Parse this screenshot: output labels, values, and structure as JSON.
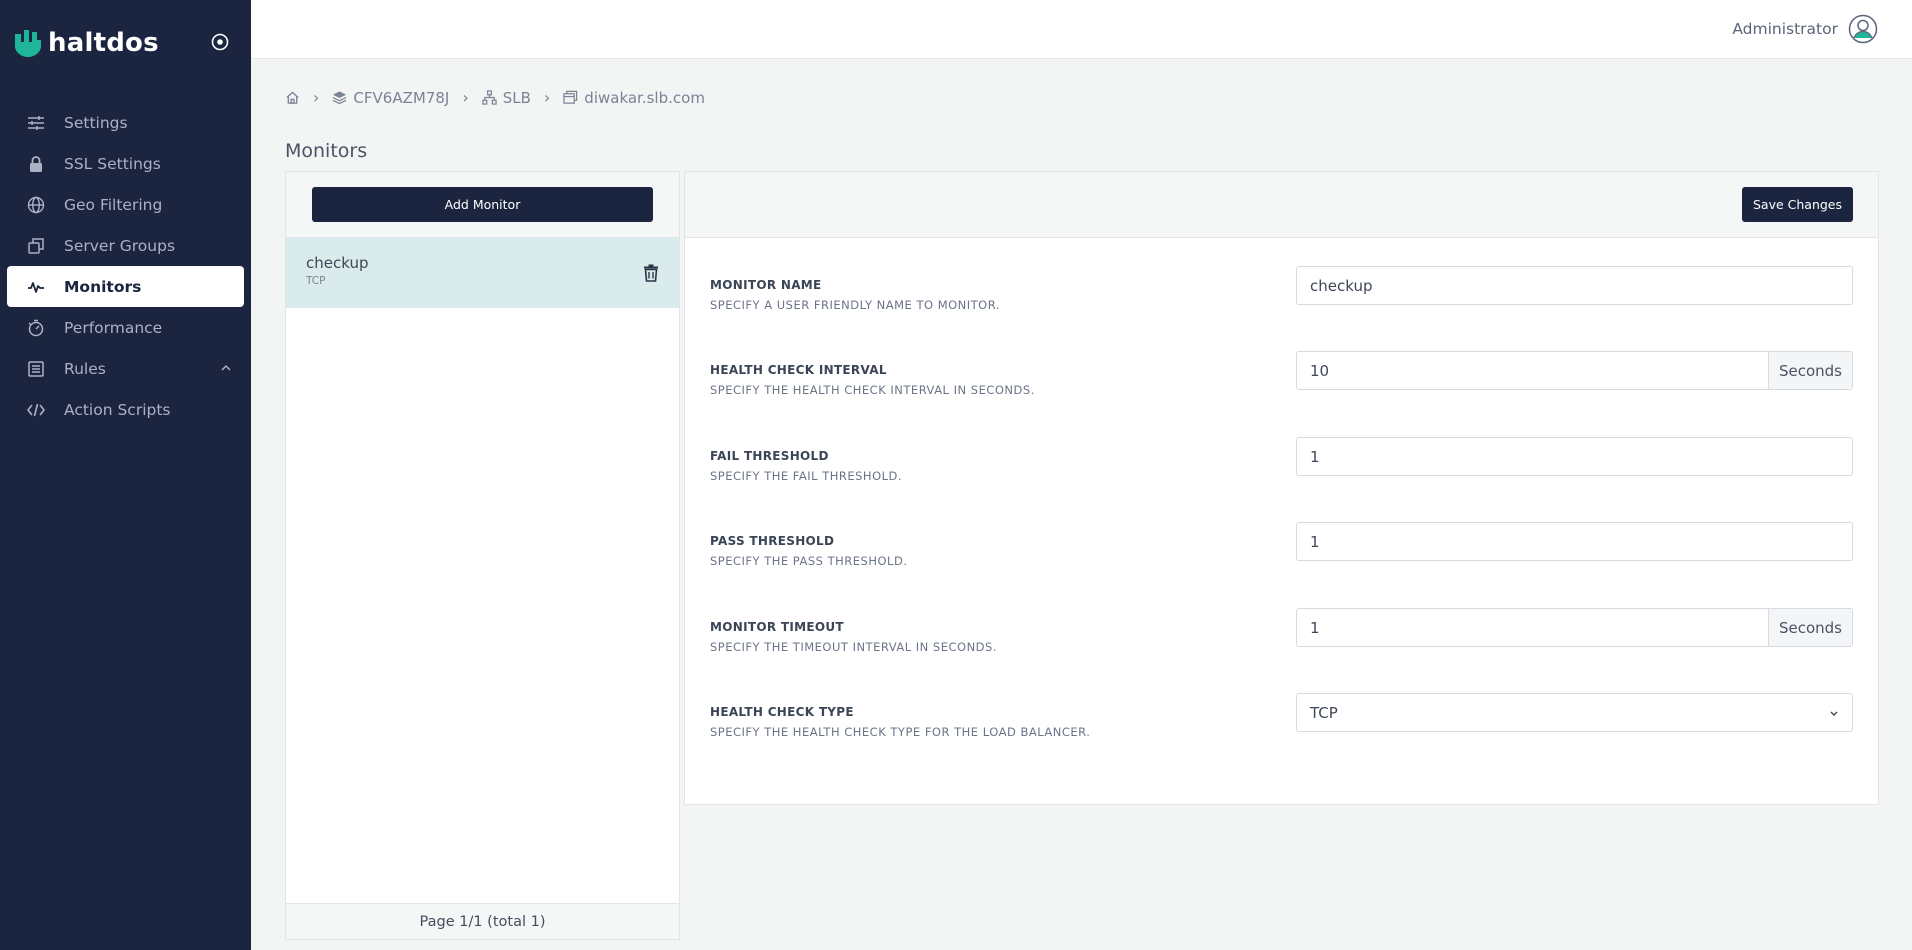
{
  "brand": {
    "name": "haltdos"
  },
  "sidebar": {
    "items": [
      {
        "label": "Settings",
        "icon": "sliders-icon",
        "active": false
      },
      {
        "label": "SSL Settings",
        "icon": "lock-icon",
        "active": false
      },
      {
        "label": "Geo Filtering",
        "icon": "globe-icon",
        "active": false
      },
      {
        "label": "Server Groups",
        "icon": "copy-icon",
        "active": false
      },
      {
        "label": "Monitors",
        "icon": "activity-icon",
        "active": true
      },
      {
        "label": "Performance",
        "icon": "stopwatch-icon",
        "active": false
      },
      {
        "label": "Rules",
        "icon": "list-icon",
        "active": false,
        "expanded": true
      },
      {
        "label": "Action Scripts",
        "icon": "code-icon",
        "active": false
      }
    ]
  },
  "header": {
    "user_name": "Administrator"
  },
  "breadcrumb": {
    "items": [
      {
        "label": "",
        "icon": "home-icon"
      },
      {
        "label": "CFV6AZM78J",
        "icon": "layers-icon"
      },
      {
        "label": "SLB",
        "icon": "sitemap-icon"
      },
      {
        "label": "diwakar.slb.com",
        "icon": "window-icon"
      }
    ]
  },
  "page": {
    "title": "Monitors"
  },
  "list": {
    "add_label": "Add Monitor",
    "items": [
      {
        "name": "checkup",
        "type": "TCP"
      }
    ],
    "pagination": "Page 1/1 (total 1)"
  },
  "form": {
    "save_label": "Save Changes",
    "fields": {
      "monitor_name": {
        "title": "MONITOR NAME",
        "help": "SPECIFY A USER FRIENDLY NAME TO MONITOR.",
        "value": "checkup"
      },
      "interval": {
        "title": "HEALTH CHECK INTERVAL",
        "help": "SPECIFY THE HEALTH CHECK INTERVAL IN SECONDS.",
        "value": "10",
        "unit": "Seconds"
      },
      "fail_threshold": {
        "title": "FAIL THRESHOLD",
        "help": "SPECIFY THE FAIL THRESHOLD.",
        "value": "1"
      },
      "pass_threshold": {
        "title": "PASS THRESHOLD",
        "help": "SPECIFY THE PASS THRESHOLD.",
        "value": "1"
      },
      "timeout": {
        "title": "MONITOR TIMEOUT",
        "help": "SPECIFY THE TIMEOUT INTERVAL IN SECONDS.",
        "value": "1",
        "unit": "Seconds"
      },
      "check_type": {
        "title": "HEALTH CHECK TYPE",
        "help": "SPECIFY THE HEALTH CHECK TYPE FOR THE LOAD BALANCER.",
        "value": "TCP"
      }
    }
  },
  "colors": {
    "sidebar_bg": "#1b2540",
    "accent": "#1fb59a",
    "selected_row": "#d9ebea",
    "button_dark": "#1b2540"
  }
}
